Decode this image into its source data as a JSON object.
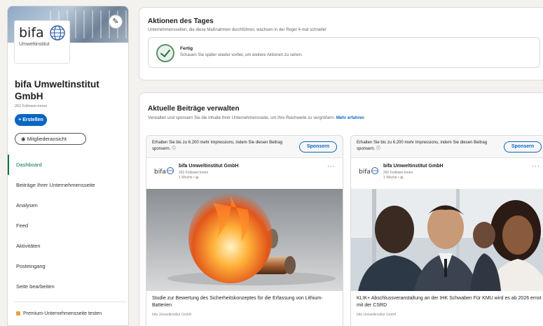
{
  "sidebar": {
    "logo_text": "bifa",
    "logo_subtext": "Umweltinstitut",
    "company_name": "bifa Umweltinstitut GmbH",
    "followers": "262 Follower:innen",
    "create_label": "+ Erstellen",
    "member_view_label": "Mitgliederansicht",
    "nav": [
      {
        "label": "Dashboard",
        "active": true
      },
      {
        "label": "Beiträge Ihrer Unternehmensseite",
        "active": false
      },
      {
        "label": "Analysen",
        "active": false
      },
      {
        "label": "Feed",
        "active": false
      },
      {
        "label": "Aktivitäten",
        "active": false
      },
      {
        "label": "Posteingang",
        "active": false
      },
      {
        "label": "Seite bearbeiten",
        "active": false
      }
    ],
    "premium_label": "Premium-Unternehmensseite testen"
  },
  "actions": {
    "title": "Aktionen des Tages",
    "subtitle": "Unternehmensseiten, die diese Maßnahmen durchführen, wachsen in der Regel 4-mal schneller",
    "done_title": "Fertig",
    "done_text": "Schauen Sie später wieder vorbei, um weitere Aktionen zu sehen."
  },
  "posts": {
    "title": "Aktuelle Beiträge verwalten",
    "subtitle": "Verwalten und sponsern Sie die Inhalte Ihrer Unternehmensseite, um Ihre Reichweite zu vergrößern.",
    "more_link": "Mehr erfahren",
    "items": [
      {
        "sponsor_text": "Erhalten Sie bis zu 6.200 mehr Impressions, indem Sie diesen Beitrag sponsern.",
        "sponsor_button": "Sponsern",
        "author": "bifa Umweltinstitut GmbH",
        "author_followers": "262 Follower:innen",
        "age": "1 Woche •",
        "title": "Studie zur Bewertung des Sicherheitskonzeptes für die Erfassung von Lithium-Batterien",
        "source": "bifa Umweltinstitut GmbH"
      },
      {
        "sponsor_text": "Erhalten Sie bis zu 6.200 mehr Impressions, indem Sie diesen Beitrag sponsern.",
        "sponsor_button": "Sponsern",
        "author": "bifa Umweltinstitut GmbH",
        "author_followers": "262 Follower:innen",
        "age": "1 Woche •",
        "title": "KLIK+ Abschlussveranstaltung an der IHK Schwaben Für KMU wird es ab 2026 ernst mit der CSRD",
        "source": "bifa Umweltinstitut GmbH"
      }
    ]
  },
  "colors": {
    "brand_blue": "#0a66c2",
    "active_green": "#057642",
    "page_bg": "#f3f2ef"
  }
}
